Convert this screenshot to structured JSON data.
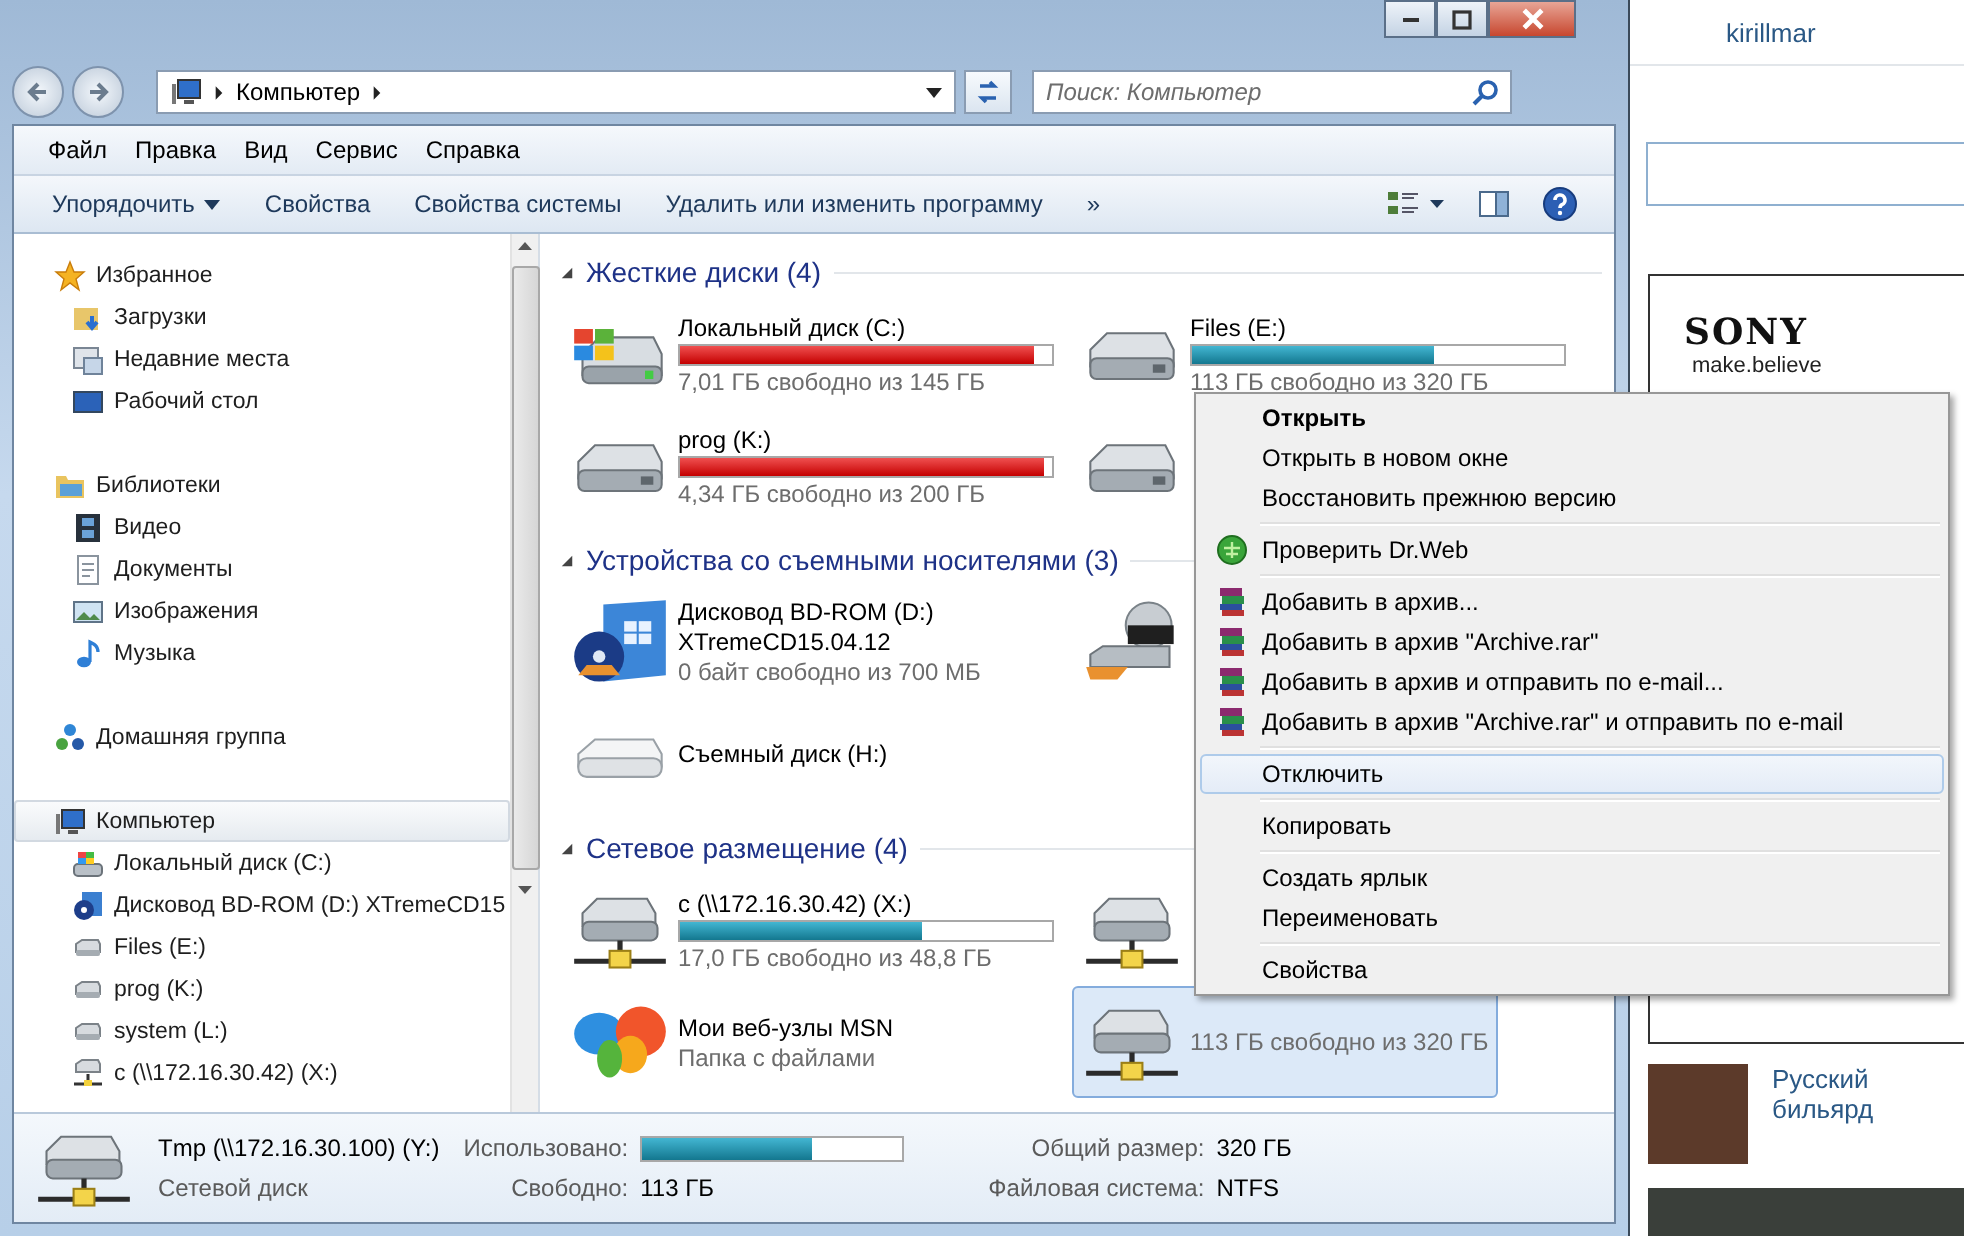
{
  "window": {
    "address": "Компьютер",
    "search_placeholder": "Поиск: Компьютер"
  },
  "menu_bar": [
    "Файл",
    "Правка",
    "Вид",
    "Сервис",
    "Справка"
  ],
  "toolbar": [
    {
      "label": "Упорядочить",
      "dropdown": true
    },
    {
      "label": "Свойства",
      "dropdown": false
    },
    {
      "label": "Свойства системы",
      "dropdown": false
    },
    {
      "label": "Удалить или изменить программу",
      "dropdown": false
    }
  ],
  "toolbar_more": "»",
  "sidebar": [
    {
      "label": "Избранное",
      "kind": "favorites",
      "selected": false,
      "children": [
        {
          "label": "Загрузки",
          "kind": "downloads",
          "selected": false
        },
        {
          "label": "Недавние места",
          "kind": "recent",
          "selected": false
        },
        {
          "label": "Рабочий стол",
          "kind": "desktop",
          "selected": false
        }
      ]
    },
    {
      "label": "Библиотеки",
      "kind": "libraries",
      "selected": false,
      "children": [
        {
          "label": "Видео",
          "kind": "video",
          "selected": false
        },
        {
          "label": "Документы",
          "kind": "documents",
          "selected": false
        },
        {
          "label": "Изображения",
          "kind": "pictures",
          "selected": false
        },
        {
          "label": "Музыка",
          "kind": "music",
          "selected": false
        }
      ]
    },
    {
      "label": "Домашняя группа",
      "kind": "homegroup",
      "selected": false
    },
    {
      "label": "Компьютер",
      "kind": "computer",
      "selected": true,
      "children": [
        {
          "label": "Локальный диск (C:)",
          "kind": "system-drive",
          "selected": false
        },
        {
          "label": "Дисковод BD-ROM (D:) XTremeCD15",
          "kind": "optical-drive",
          "selected": false
        },
        {
          "label": "Files (E:)",
          "kind": "drive",
          "selected": false
        },
        {
          "label": "prog (K:)",
          "kind": "drive",
          "selected": false
        },
        {
          "label": "system (L:)",
          "kind": "drive",
          "selected": false
        },
        {
          "label": "c (\\\\172.16.30.42) (X:)",
          "kind": "network-drive",
          "selected": false
        }
      ]
    }
  ],
  "groups": [
    {
      "title": "Жесткие диски (4)",
      "expanded": true,
      "items": [
        {
          "kind": "system-drive",
          "name": "Локальный диск (C:)",
          "level": 0.95,
          "almost_full": true,
          "free": "7,01 ГБ свободно из 145 ГБ",
          "selected": false
        },
        {
          "kind": "drive",
          "name": "Files (E:)",
          "level": 0.65,
          "almost_full": false,
          "free": "113 ГБ свободно из 320 ГБ",
          "selected": false
        },
        {
          "kind": "drive",
          "name": "prog (K:)",
          "level": 0.98,
          "almost_full": true,
          "free": "4,34 ГБ свободно из 200 ГБ",
          "selected": false
        },
        {
          "kind": "drive",
          "selected": false
        }
      ]
    },
    {
      "title": "Устройства со съемными носителями (3)",
      "expanded": true,
      "items": [
        {
          "kind": "optical-drive",
          "name": "Дисковод BD-ROM (D:)",
          "label": "XTremeCD15.04.12",
          "free": "0 байт свободно из 700 МБ",
          "selected": false
        },
        {
          "kind": "dvd-drive",
          "selected": false
        },
        {
          "kind": "removable",
          "name": "Съемный диск (H:)",
          "selected": false
        }
      ]
    },
    {
      "title": "Сетевое размещение (4)",
      "expanded": true,
      "items": [
        {
          "kind": "network-drive",
          "name": "c (\\\\172.16.30.42) (X:)",
          "level": 0.65,
          "almost_full": false,
          "free": "17,0 ГБ свободно из 48,8 ГБ",
          "selected": false
        },
        {
          "kind": "network-drive",
          "selected": false
        },
        {
          "kind": "msn-folder",
          "name": "Мои веб-узлы MSN",
          "type_text": "Папка с файлами",
          "selected": false
        },
        {
          "kind": "network-drive",
          "free": "113 ГБ свободно из 320 ГБ",
          "selected": true
        }
      ]
    }
  ],
  "details": {
    "name": "Tmp (\\\\172.16.30.100) (Y:)",
    "type_text": "Сетевой диск",
    "used_label": "Использовано:",
    "level": 0.65,
    "free_label": "Свободно:",
    "free": "113 ГБ",
    "total_label": "Общий размер:",
    "total": "320 ГБ",
    "fs_label": "Файловая система:",
    "fs": "NTFS"
  },
  "context_menu": [
    {
      "kind": "item",
      "label": "Открыть",
      "default": true,
      "selected": false
    },
    {
      "kind": "item",
      "label": "Открыть в новом окне",
      "default": false,
      "selected": false
    },
    {
      "kind": "item",
      "label": "Восстановить прежнюю версию",
      "default": false,
      "selected": false
    },
    {
      "kind": "separator"
    },
    {
      "kind": "scan",
      "label": "Проверить Dr.Web",
      "default": false,
      "selected": false
    },
    {
      "kind": "separator"
    },
    {
      "kind": "archive",
      "label": "Добавить в архив...",
      "default": false,
      "selected": false
    },
    {
      "kind": "archive",
      "label": "Добавить в архив \"Archive.rar\"",
      "default": false,
      "selected": false
    },
    {
      "kind": "archive",
      "label": "Добавить в архив и отправить по e-mail...",
      "default": false,
      "selected": false
    },
    {
      "kind": "archive",
      "label": "Добавить в архив \"Archive.rar\" и отправить по e-mail",
      "default": false,
      "selected": false
    },
    {
      "kind": "separator"
    },
    {
      "kind": "item",
      "label": "Отключить",
      "default": false,
      "selected": true
    },
    {
      "kind": "separator"
    },
    {
      "kind": "item",
      "label": "Копировать",
      "default": false,
      "selected": false
    },
    {
      "kind": "separator"
    },
    {
      "kind": "item",
      "label": "Создать ярлык",
      "default": false,
      "selected": false
    },
    {
      "kind": "item",
      "label": "Переименовать",
      "default": false,
      "selected": false
    },
    {
      "kind": "separator"
    },
    {
      "kind": "item",
      "label": "Свойства",
      "default": false,
      "selected": false
    }
  ],
  "web_page": {
    "user_link": "kirillmar",
    "ad": {
      "brand": "SONY",
      "slogan": "make.believe"
    },
    "links": [
      {
        "label": "Русский бильярд"
      }
    ]
  }
}
